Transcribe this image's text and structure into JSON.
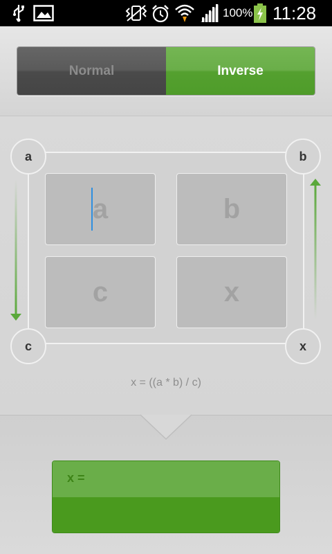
{
  "status_bar": {
    "battery_percent": "100%",
    "time": "11:28",
    "icons": [
      "usb-icon",
      "image-icon",
      "vibrate-icon",
      "alarm-icon",
      "wifi-icon",
      "signal-icon",
      "battery-charging-icon"
    ]
  },
  "mode_toggle": {
    "normal_label": "Normal",
    "inverse_label": "Inverse",
    "selected": "Inverse"
  },
  "corners": {
    "top_left": "a",
    "top_right": "b",
    "bottom_left": "c",
    "bottom_right": "x"
  },
  "cells": {
    "a": {
      "placeholder": "a",
      "value": ""
    },
    "b": {
      "placeholder": "b",
      "value": ""
    },
    "c": {
      "placeholder": "c",
      "value": ""
    },
    "x": {
      "placeholder": "x",
      "value": ""
    }
  },
  "formula": "x = ((a * b) / c)",
  "result": {
    "label": "x =",
    "value": ""
  },
  "colors": {
    "accent_green": "#5aa83a",
    "dark_green": "#4a9a1e",
    "caret_blue": "#2e8fe0"
  }
}
